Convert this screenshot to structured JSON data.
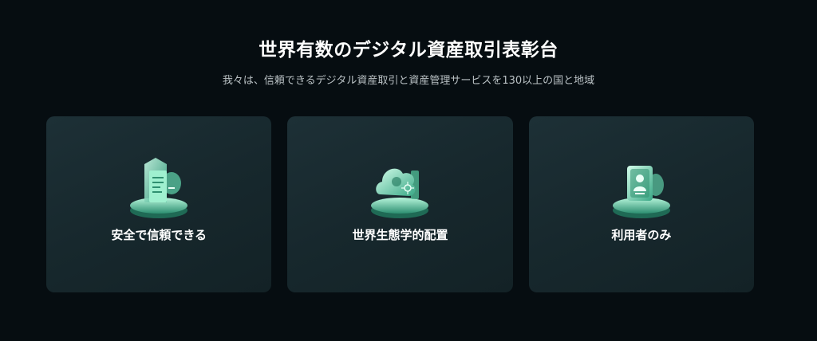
{
  "header": {
    "title": "世界有数のデジタル資産取引表彰台",
    "subtitle": "我々は、信頼できるデジタル資産取引と資産管理サービスを130以上の国と地域"
  },
  "cards": [
    {
      "label": "安全で信頼できる",
      "icon": "secure-document-icon"
    },
    {
      "label": "世界生態学的配置",
      "icon": "cloud-network-icon"
    },
    {
      "label": "利用者のみ",
      "icon": "user-profile-icon"
    }
  ],
  "colors": {
    "background": "#060d11",
    "card": "#1b2d32",
    "accent": "#7fe0c0"
  }
}
